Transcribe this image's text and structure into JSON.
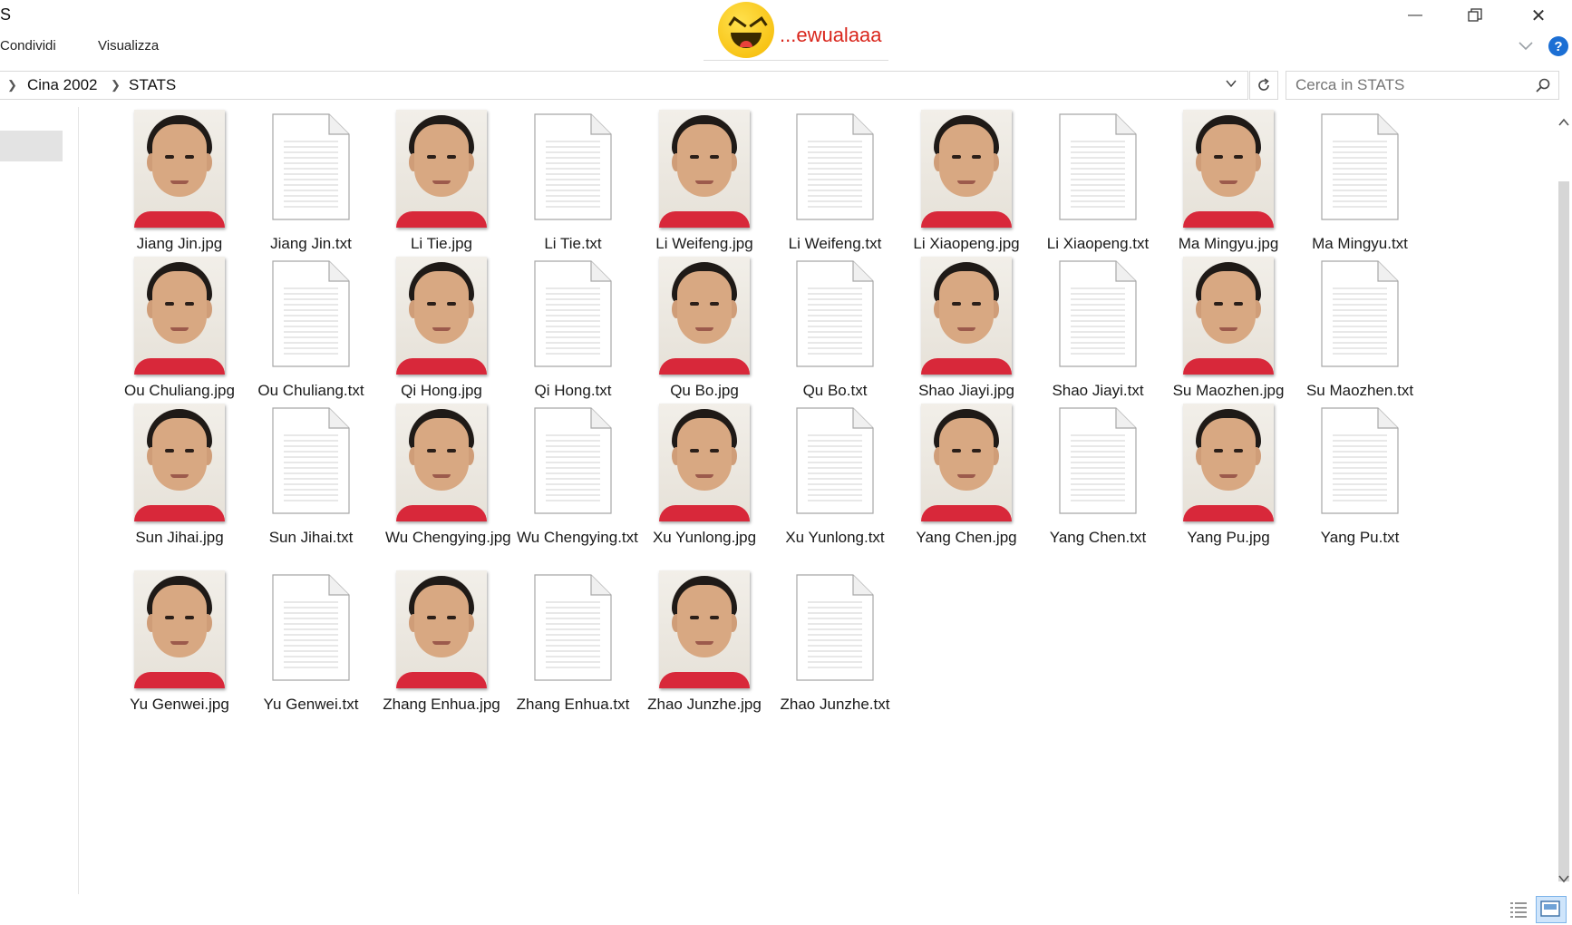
{
  "window": {
    "title": "S",
    "minimize_glyph": "—",
    "close_glyph": "✕"
  },
  "ribbon": {
    "tabs": [
      {
        "label": "Condividi"
      },
      {
        "label": "Visualizza"
      }
    ],
    "help_label": "?"
  },
  "watermark": {
    "text": "...ewualaaa",
    "icon": "laughing-emoji-icon"
  },
  "address": {
    "crumbs": [
      {
        "label": "Cina 2002"
      },
      {
        "label": "STATS"
      }
    ]
  },
  "search": {
    "placeholder": "Cerca in STATS",
    "value": ""
  },
  "files": [
    {
      "name": "Jiang Jin.jpg",
      "kind": "photo"
    },
    {
      "name": "Jiang Jin.txt",
      "kind": "text"
    },
    {
      "name": "Li Tie.jpg",
      "kind": "photo"
    },
    {
      "name": "Li Tie.txt",
      "kind": "text"
    },
    {
      "name": "Li Weifeng.jpg",
      "kind": "photo"
    },
    {
      "name": "Li Weifeng.txt",
      "kind": "text"
    },
    {
      "name": "Li Xiaopeng.jpg",
      "kind": "photo"
    },
    {
      "name": "Li Xiaopeng.txt",
      "kind": "text"
    },
    {
      "name": "Ma Mingyu.jpg",
      "kind": "photo"
    },
    {
      "name": "Ma Mingyu.txt",
      "kind": "text"
    },
    {
      "name": "Ou Chuliang.jpg",
      "kind": "photo"
    },
    {
      "name": "Ou Chuliang.txt",
      "kind": "text"
    },
    {
      "name": "Qi Hong.jpg",
      "kind": "photo"
    },
    {
      "name": "Qi Hong.txt",
      "kind": "text"
    },
    {
      "name": "Qu Bo.jpg",
      "kind": "photo"
    },
    {
      "name": "Qu Bo.txt",
      "kind": "text"
    },
    {
      "name": "Shao Jiayi.jpg",
      "kind": "photo"
    },
    {
      "name": "Shao Jiayi.txt",
      "kind": "text"
    },
    {
      "name": "Su Maozhen.jpg",
      "kind": "photo"
    },
    {
      "name": "Su Maozhen.txt",
      "kind": "text"
    },
    {
      "name": "Sun Jihai.jpg",
      "kind": "photo"
    },
    {
      "name": "Sun Jihai.txt",
      "kind": "text"
    },
    {
      "name": "Wu Chengying.jpg",
      "kind": "photo"
    },
    {
      "name": "Wu Chengying.txt",
      "kind": "text"
    },
    {
      "name": "Xu Yunlong.jpg",
      "kind": "photo"
    },
    {
      "name": "Xu Yunlong.txt",
      "kind": "text"
    },
    {
      "name": "Yang Chen.jpg",
      "kind": "photo"
    },
    {
      "name": "Yang Chen.txt",
      "kind": "text"
    },
    {
      "name": "Yang Pu.jpg",
      "kind": "photo"
    },
    {
      "name": "Yang Pu.txt",
      "kind": "text"
    },
    {
      "name": "Yu Genwei.jpg",
      "kind": "photo"
    },
    {
      "name": "Yu Genwei.txt",
      "kind": "text"
    },
    {
      "name": "Zhang Enhua.jpg",
      "kind": "photo"
    },
    {
      "name": "Zhang Enhua.txt",
      "kind": "text"
    },
    {
      "name": "Zhao Junzhe.jpg",
      "kind": "photo"
    },
    {
      "name": "Zhao Junzhe.txt",
      "kind": "text"
    }
  ],
  "colors": {
    "help_badge": "#1c6fd4",
    "jersey_red": "#d8283a",
    "watermark_red": "#d9261c",
    "selected_view": "#cfe5fb"
  }
}
